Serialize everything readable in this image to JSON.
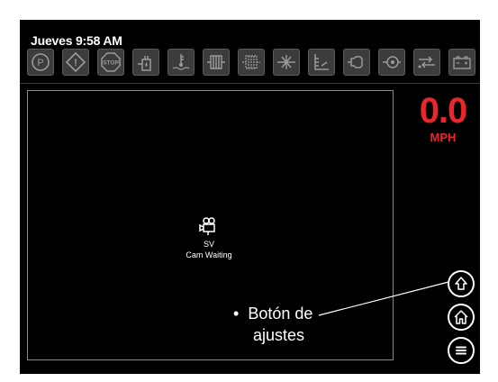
{
  "status_bar": {
    "datetime": "Jueves 9:58 AM"
  },
  "indicators": [
    {
      "icon": "parking-brake-icon",
      "label": "P"
    },
    {
      "icon": "warning-icon",
      "label": "!"
    },
    {
      "icon": "stop-icon",
      "label": "STOP"
    },
    {
      "icon": "hydraulic-oil-icon"
    },
    {
      "icon": "coolant-temp-icon"
    },
    {
      "icon": "filter-icon"
    },
    {
      "icon": "filter-restriction-icon"
    },
    {
      "icon": "filter-bypass-icon"
    },
    {
      "icon": "oil-level-icon"
    },
    {
      "icon": "engine-icon"
    },
    {
      "icon": "transmission-icon"
    },
    {
      "icon": "sensor-icon"
    },
    {
      "icon": "battery-icon"
    }
  ],
  "camera": {
    "icon": "camera-icon",
    "name": "SV",
    "status": "Cam Waiting"
  },
  "speed": {
    "value": "0.0",
    "unit": "MPH",
    "color": "#e8262b"
  },
  "side_buttons": [
    {
      "icon": "settings-arrow-icon"
    },
    {
      "icon": "home-icon"
    },
    {
      "icon": "menu-icon"
    }
  ],
  "callout": {
    "bullet": "•",
    "line1": "Botón de",
    "line2": "ajustes"
  }
}
